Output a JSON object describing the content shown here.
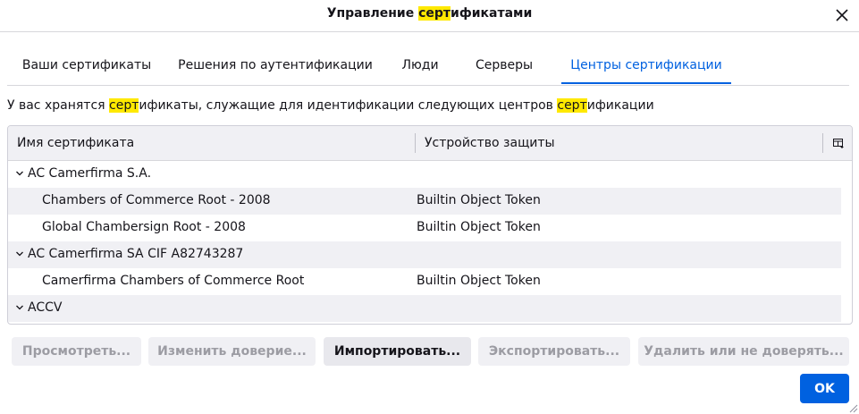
{
  "dialog": {
    "title_parts": [
      "Управление ",
      "серт",
      "ификатами"
    ],
    "close_icon": "close-icon"
  },
  "tabs": [
    {
      "label": "Ваши сертификаты",
      "active": false
    },
    {
      "label": "Решения по аутентификации",
      "active": false
    },
    {
      "label": "Люди",
      "active": false
    },
    {
      "label": "Серверы",
      "active": false
    },
    {
      "label": "Центры сертификации",
      "active": true
    }
  ],
  "description_parts": [
    "У вас хранятся ",
    "серт",
    "ификаты, служащие для идентификации следующих центров ",
    "серт",
    "ификации"
  ],
  "table": {
    "columns": [
      "Имя сертификата",
      "Устройство защиты"
    ],
    "column_picker_icon": "column-picker-icon",
    "rows": [
      {
        "type": "group",
        "name": "AC Camerfirma S.A.",
        "device": ""
      },
      {
        "type": "cert",
        "name": "Chambers of Commerce Root - 2008",
        "device": "Builtin Object Token"
      },
      {
        "type": "cert",
        "name": "Global Chambersign Root - 2008",
        "device": "Builtin Object Token"
      },
      {
        "type": "group",
        "name": "AC Camerfirma SA CIF A82743287",
        "device": ""
      },
      {
        "type": "cert",
        "name": "Camerfirma Chambers of Commerce Root",
        "device": "Builtin Object Token"
      },
      {
        "type": "group",
        "name": "ACCV",
        "device": ""
      }
    ]
  },
  "buttons": {
    "view": "Просмотреть...",
    "edit_trust": "Изменить доверие...",
    "import": "Импортировать...",
    "export": "Экспортировать...",
    "delete_distrust": "Удалить или не доверять...",
    "ok": "OK"
  },
  "colors": {
    "accent": "#0061e0",
    "highlight": "#ffe900",
    "row_alt": "#f0f0f4"
  }
}
